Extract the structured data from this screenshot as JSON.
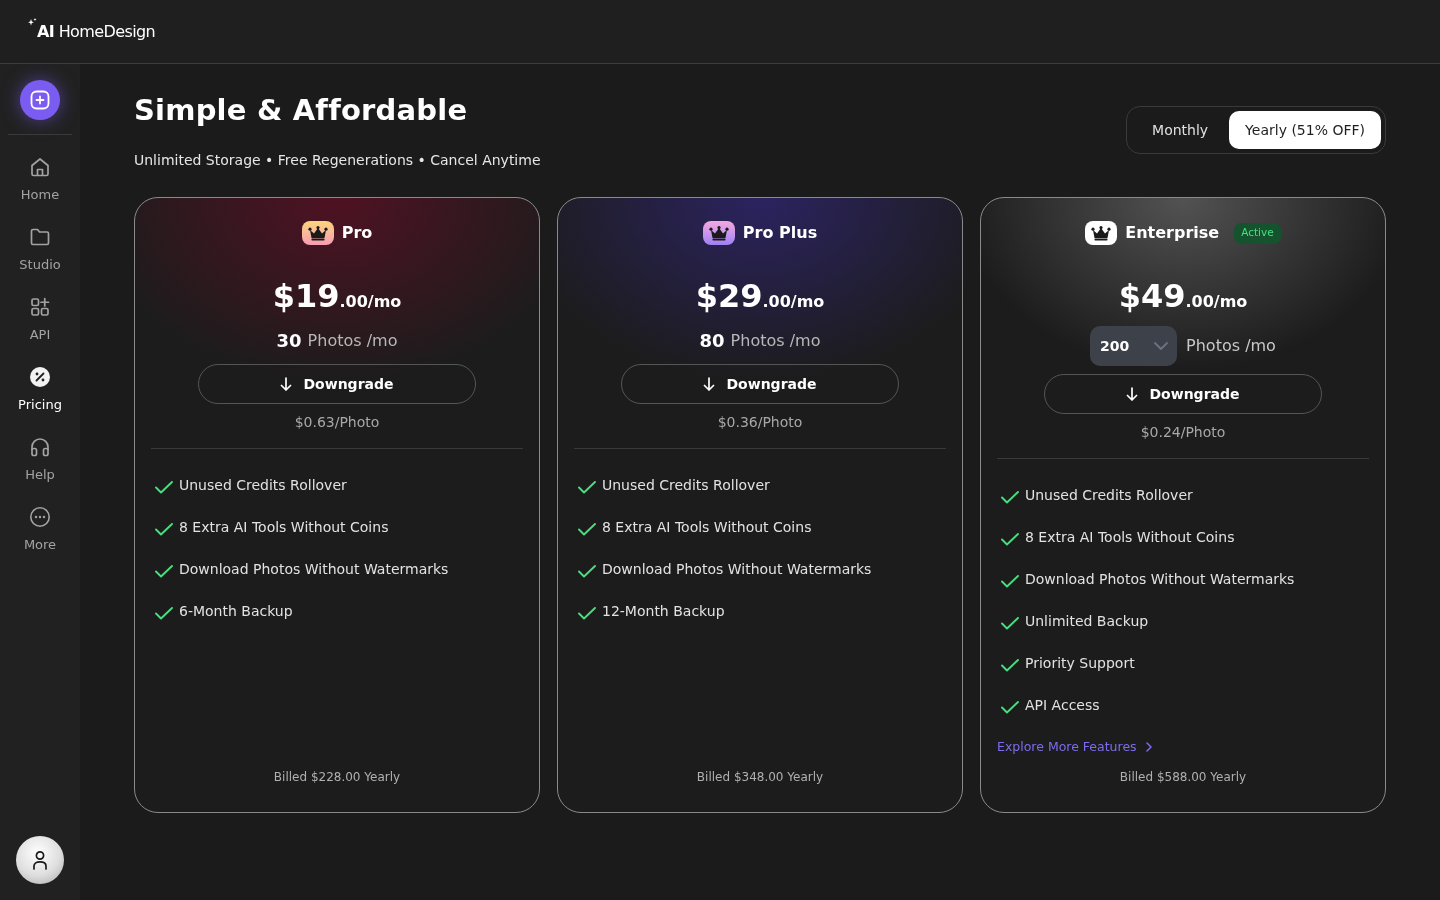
{
  "header": {
    "logo": "**AI** HomeDesign"
  },
  "sidebar": {
    "items": [
      {
        "label": "Home",
        "selected": false
      },
      {
        "label": "Studio",
        "selected": false
      },
      {
        "label": "API",
        "selected": false
      },
      {
        "label": "Pricing",
        "selected": true
      },
      {
        "label": "Help",
        "selected": false
      },
      {
        "label": "More",
        "selected": false
      }
    ]
  },
  "page": {
    "title": "Simple & Affordable",
    "subtitle": "Unlimited Storage • Free Regenerations • Cancel Anytime"
  },
  "billing_toggle": [
    {
      "label": "Monthly",
      "selected": false
    },
    {
      "label": "Yearly (51% OFF)",
      "selected": true
    }
  ],
  "plans": [
    {
      "kind": "pro",
      "name": "Pro",
      "price": "$19",
      "price_suffix": ".00/mo",
      "photos": {
        "kind": "count",
        "value": "30"
      },
      "photos_unit": "Photos /mo",
      "button": "Downgrade",
      "per_photo": "$0.63/Photo",
      "features": [
        "Unused Credits Rollover",
        "8 Extra AI Tools Without Coins",
        "Download Photos Without Watermarks",
        "6-Month Backup"
      ],
      "billed": "Billed $228.00 Yearly"
    },
    {
      "kind": "pro_plus",
      "name": "Pro Plus",
      "price": "$29",
      "price_suffix": ".00/mo",
      "photos": {
        "kind": "count",
        "value": "80"
      },
      "photos_unit": "Photos /mo",
      "button": "Downgrade",
      "per_photo": "$0.36/Photo",
      "features": [
        "Unused Credits Rollover",
        "8 Extra AI Tools Without Coins",
        "Download Photos Without Watermarks",
        "12-Month Backup"
      ],
      "billed": "Billed $348.00 Yearly"
    },
    {
      "kind": "enterprise",
      "name": "Enterprise",
      "badge": "Active",
      "price": "$49",
      "price_suffix": ".00/mo",
      "photos": {
        "kind": "dropdown",
        "value": "200"
      },
      "photos_unit": "Photos /mo",
      "button": "Downgrade",
      "per_photo": "$0.24/Photo",
      "features": [
        "Unused Credits Rollover",
        "8 Extra AI Tools Without Coins",
        "Download Photos Without Watermarks",
        "Unlimited Backup",
        "Priority Support",
        "API Access"
      ],
      "link": "Explore More Features",
      "billed": "Billed $588.00 Yearly"
    }
  ]
}
